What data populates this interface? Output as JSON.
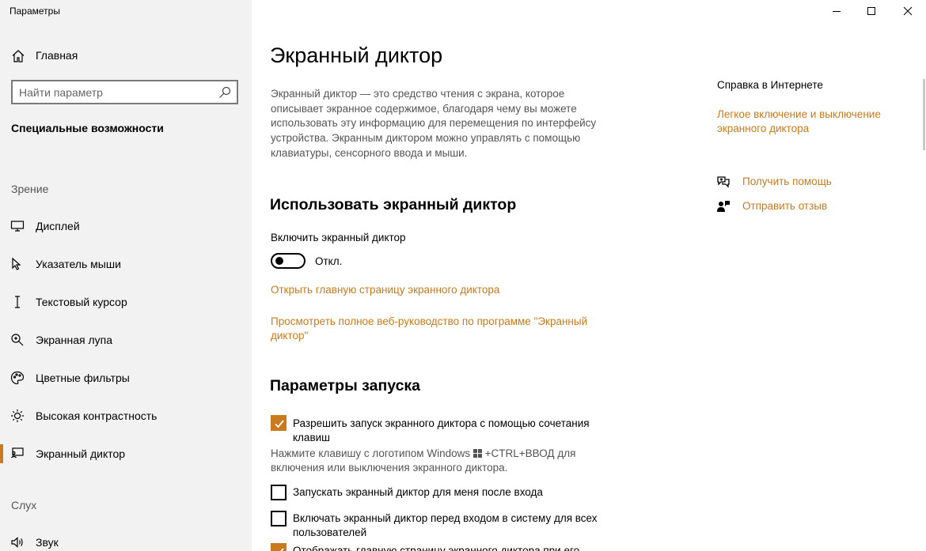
{
  "window": {
    "title": "Параметры"
  },
  "sidebar": {
    "home_label": "Главная",
    "search_placeholder": "Найти параметр",
    "section_title": "Специальные возможности",
    "groups": [
      {
        "label": "Зрение"
      },
      {
        "label": "Слух"
      }
    ],
    "items": [
      {
        "label": "Дисплей",
        "icon": "display-icon"
      },
      {
        "label": "Указатель мыши",
        "icon": "mouse-pointer-icon"
      },
      {
        "label": "Текстовый курсор",
        "icon": "text-cursor-icon"
      },
      {
        "label": "Экранная лупа",
        "icon": "magnifier-icon"
      },
      {
        "label": "Цветные фильтры",
        "icon": "color-filters-icon"
      },
      {
        "label": "Высокая контрастность",
        "icon": "high-contrast-icon"
      },
      {
        "label": "Экранный диктор",
        "icon": "narrator-icon",
        "active": true
      },
      {
        "label": "Звук",
        "icon": "speaker-icon"
      }
    ]
  },
  "main": {
    "title": "Экранный диктор",
    "description": "Экранный диктор — это средство чтения с экрана, которое описывает экранное содержимое, благодаря чему вы можете использовать эту информацию для перемещения по интерфейсу устройства. Экранным диктором можно управлять с помощью клавиатуры, сенсорного ввода и мыши.",
    "use_section": {
      "heading": "Использовать экранный диктор",
      "toggle_label": "Включить экранный диктор",
      "toggle_state": "Откл.",
      "toggle_on": false,
      "link_home": "Открыть главную страницу экранного диктора",
      "link_guide": "Просмотреть полное веб-руководство по программе \"Экранный диктор\""
    },
    "startup_section": {
      "heading": "Параметры запуска",
      "options": [
        {
          "label": "Разрешить запуск экранного диктора с помощью сочетания клавиш",
          "checked": true
        },
        {
          "label": "Запускать экранный диктор для меня после входа",
          "checked": false
        },
        {
          "label": "Включать экранный диктор перед входом в систему для всех пользователей",
          "checked": false
        }
      ],
      "hint_part1": "Нажмите клавишу с логотипом Windows",
      "hint_part2": "+CTRL+ВВОД для включения или выключения экранного диктора.",
      "partial_option_label": "Отображать главную страницу экранного диктора при его"
    }
  },
  "aside": {
    "help_title": "Справка в Интернете",
    "help_link": "Легкое включение и выключение экранного диктора",
    "get_help": "Получить помощь",
    "feedback": "Отправить отзыв"
  },
  "colors": {
    "accent": "#c87a1c",
    "sidebar_bg": "#f2f2f2",
    "secondary_text": "#555555"
  }
}
